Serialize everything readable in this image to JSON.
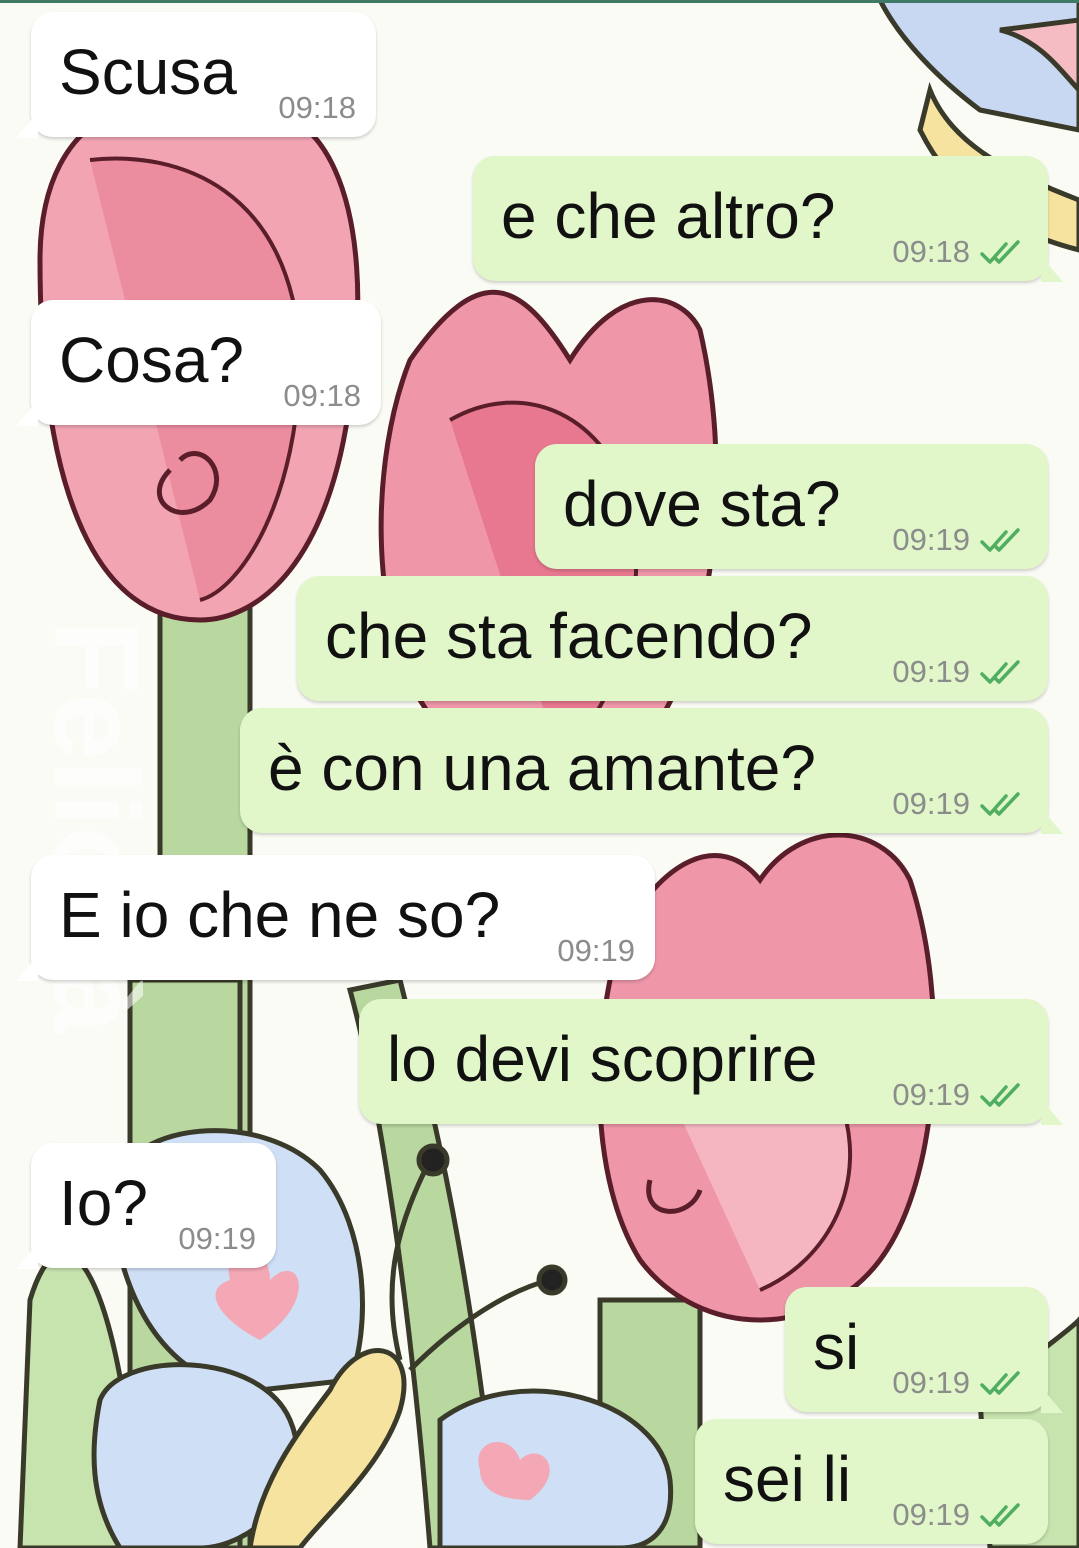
{
  "chat": {
    "messages": [
      {
        "direction": "in",
        "text": "Scusa",
        "time": "09:18"
      },
      {
        "direction": "out",
        "text": "e che altro?",
        "time": "09:18",
        "status": "read"
      },
      {
        "direction": "in",
        "text": "Cosa?",
        "time": "09:18"
      },
      {
        "direction": "out",
        "text": "dove sta?",
        "time": "09:19",
        "status": "read"
      },
      {
        "direction": "out",
        "text": "che sta facendo?",
        "time": "09:19",
        "status": "read"
      },
      {
        "direction": "out",
        "text": "è con una amante?",
        "time": "09:19",
        "status": "read"
      },
      {
        "direction": "in",
        "text": "E io che ne so?",
        "time": "09:19"
      },
      {
        "direction": "out",
        "text": "lo devi scoprire",
        "time": "09:19",
        "status": "read"
      },
      {
        "direction": "in",
        "text": "Io?",
        "time": "09:19"
      },
      {
        "direction": "out",
        "text": "si",
        "time": "09:19",
        "status": "read"
      },
      {
        "direction": "out",
        "text": "sei li",
        "time": "09:19",
        "status": "read"
      }
    ]
  },
  "colors": {
    "incoming_bubble": "#ffffff",
    "outgoing_bubble": "#e1f6c9",
    "timestamp": "#8b8d8a",
    "read_ticks": "#4fae5f",
    "top_bar": "#3f7a66"
  },
  "icons": {
    "read_receipt": "double-check-icon"
  },
  "wallpaper": {
    "theme": "pink tulips with pastel butterflies",
    "watermark": "Felicità"
  }
}
